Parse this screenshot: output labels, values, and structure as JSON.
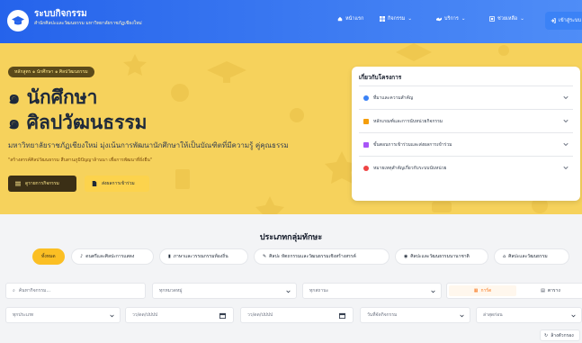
{
  "brand": {
    "title": "ระบบกิจกรรม",
    "subtitle": "สำนักศิลปะและวัฒนธรรม มหาวิทยาลัยราชภัฏเชียงใหม่"
  },
  "nav": {
    "home": "หน้าแรก",
    "activities": "กิจกรรม",
    "services": "บริการ",
    "help": "ช่วยเหลือ",
    "login": "เข้าสู่ระบบ"
  },
  "hero": {
    "pill": "หลักสูตร ๑ นักศึกษา ๑ ศิลปวัฒนธรรม",
    "line1": "๑ นักศึกษา",
    "line2": "๑ ศิลปวัฒนธรรม",
    "description": "มหาวิทยาลัยราชภัฏเชียงใหม่ มุ่งเน้นการพัฒนานักศึกษาให้เป็นบัณฑิตที่มีความรู้ คู่คุณธรรม",
    "slogan": "\"สร้างสรรค์ศิลปวัฒนธรรม สืบสานภูมิปัญญาล้านนา เพื่อการพัฒนาที่ยั่งยืน\"",
    "btn_activities": "ดูรายการกิจกรรม",
    "btn_submit": "ส่งผลการเข้าร่วม"
  },
  "panel": {
    "title": "เกี่ยวกับโครงการ",
    "items": [
      {
        "label": "ที่มาและความสำคัญ",
        "color": "#3b82f6"
      },
      {
        "label": "หลักเกณฑ์และการนับหน่วยกิจกรรม",
        "color": "#f59e0b"
      },
      {
        "label": "ขั้นตอนการเข้าร่วมและส่งผลการเข้าร่วม",
        "color": "#a855f7"
      },
      {
        "label": "หมายเหตุสำคัญเกี่ยวกับระบบนับหน่วย",
        "color": "#ef4444"
      }
    ]
  },
  "categories": {
    "title": "ประเภทกลุ่มทักษะ",
    "items": [
      "ทั้งหมด",
      "ดนตรีและศิลปะการแสดง",
      "ภาษาและวรรณกรรมท้องถิ่น",
      "ศิลปะ หัตถกรรมและวัฒนธรรมเชิงสร้างสรรค์",
      "ศิลปะและวัฒนธรรมนานาชาติ",
      "ศิลปะและวัฒนธรรม"
    ]
  },
  "filters": {
    "search_placeholder": "ค้นหากิจกรรม...",
    "select_category": "ทุกหมวดหมู่",
    "select_skill": "ทุกสถานะ",
    "view_card": "การ์ด",
    "view_table": "ตาราง",
    "select_type": "ทุกประเภท",
    "date_from": "วว/ดด/ปปปป",
    "date_to": "วว/ดด/ปปปป",
    "sort": "วันที่จัดกิจกรรม",
    "order": "ล่าสุดก่อน",
    "reset": "ล้างตัวกรอง"
  }
}
